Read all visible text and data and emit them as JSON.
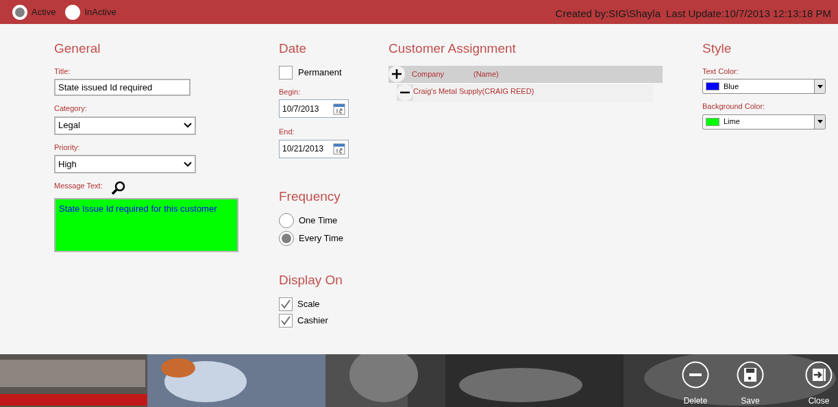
{
  "status_options": [
    {
      "label": "Active",
      "selected": true
    },
    {
      "label": "InActive",
      "selected": false
    }
  ],
  "created_by": "Created by:SIG\\Shayla",
  "last_update": "Last Update:10/7/2013 12:13:18 PM",
  "general": {
    "heading": "General",
    "title": {
      "label": "Title:",
      "value": "State issued Id required"
    },
    "category": {
      "label": "Category:",
      "value": "Legal"
    },
    "priority": {
      "label": "Priority:",
      "value": "High"
    },
    "message": {
      "label": "Message Text:",
      "value": "State Issue Id required for this customer"
    }
  },
  "date": {
    "heading": "Date",
    "permanent": {
      "label": "Permanent",
      "checked": false
    },
    "begin": {
      "label": "Begin:",
      "value": "10/7/2013"
    },
    "end": {
      "label": "End:",
      "value": "10/21/2013"
    }
  },
  "frequency": {
    "heading": "Frequency",
    "options": [
      {
        "label": "One Time",
        "selected": false
      },
      {
        "label": "Every Time",
        "selected": true
      }
    ]
  },
  "display_on": {
    "heading": "Display On",
    "options": [
      {
        "label": "Scale",
        "checked": true
      },
      {
        "label": "Cashier",
        "checked": true
      }
    ]
  },
  "customer_assignment": {
    "heading": "Customer Assignment",
    "header": {
      "column_1": "Company",
      "column_2": "(Name)"
    },
    "rows": [
      {
        "text": "Craig's Metal Supply(CRAIG REED)"
      }
    ]
  },
  "style": {
    "heading": "Style",
    "text_color": {
      "label": "Text Color:",
      "value": "Blue",
      "color": "#0000ff"
    },
    "background_color": {
      "label": "Background Color:",
      "value": "Lime",
      "color": "#00ff00"
    }
  },
  "actions": [
    {
      "label": "Delete",
      "kind": "delete"
    },
    {
      "label": "Save",
      "kind": "save"
    },
    {
      "label": "Close",
      "kind": "close"
    }
  ]
}
